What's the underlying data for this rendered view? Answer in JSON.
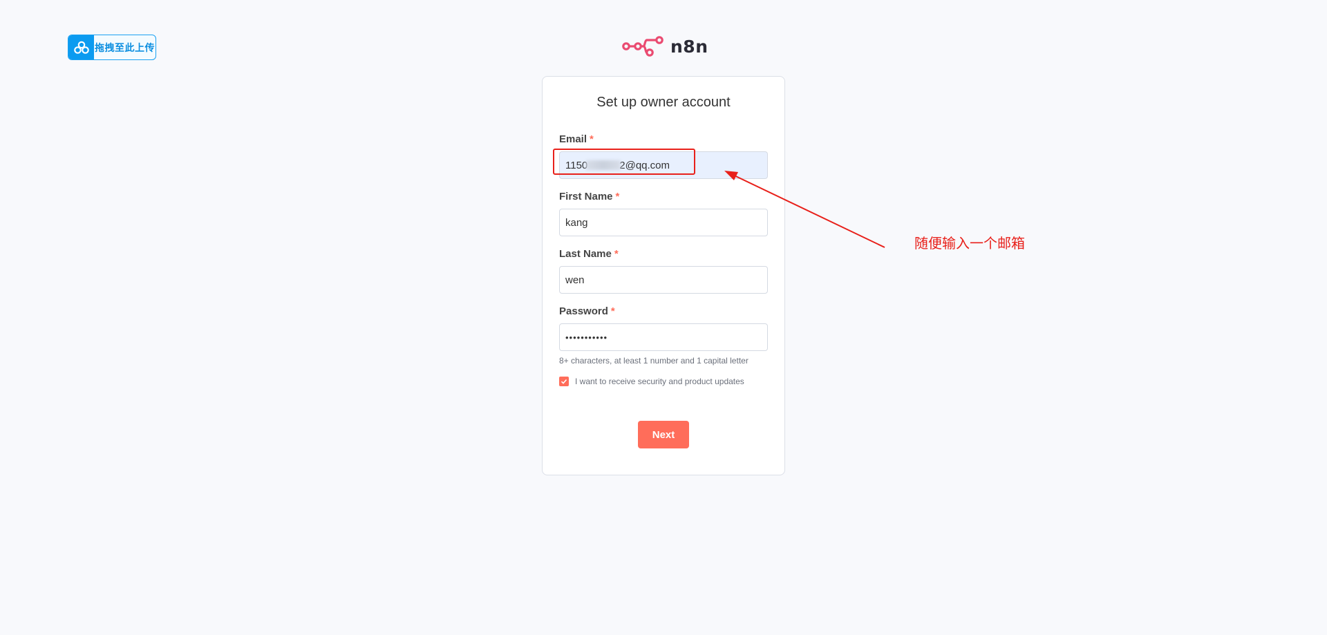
{
  "upload_badge": {
    "label": "拖拽至此上传",
    "icon": "cloud-share-icon"
  },
  "logo": {
    "text": "n8n",
    "icon": "n8n-nodes-icon"
  },
  "form": {
    "title": "Set up owner account",
    "required_mark": "*",
    "email": {
      "label": "Email",
      "value_prefix": "1150",
      "value_suffix": "2@qq.com"
    },
    "first_name": {
      "label": "First Name",
      "value": "kang"
    },
    "last_name": {
      "label": "Last Name",
      "value": "wen"
    },
    "password": {
      "label": "Password",
      "value": "•••••••••••",
      "hint": "8+ characters, at least 1 number and 1 capital letter"
    },
    "updates_checkbox": {
      "label": "I want to receive security and product updates",
      "checked": true
    },
    "next_label": "Next"
  },
  "annotation": {
    "text": "随便输入一个邮箱",
    "color": "#e8201a"
  },
  "colors": {
    "accent": "#ff6d5a",
    "logo_pink": "#ea4b71",
    "upload_blue": "#0c9bf0"
  }
}
